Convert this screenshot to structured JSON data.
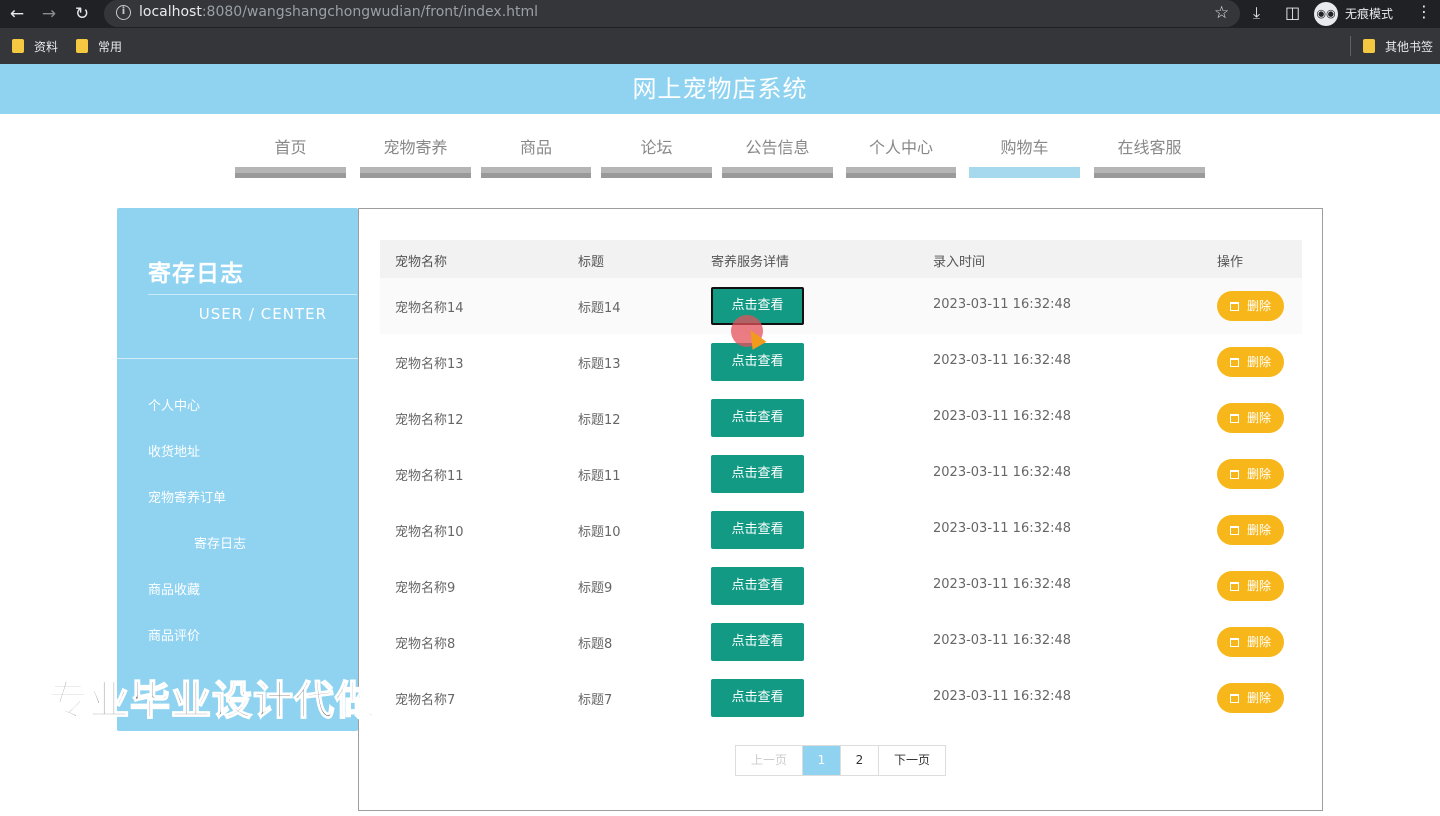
{
  "browser": {
    "url_host": "localhost",
    "url_path": ":8080/wangshangchongwudian/front/index.html",
    "incognito_label": "无痕模式",
    "bookmarks": [
      "资料",
      "常用"
    ],
    "other_bookmarks": "其他书签"
  },
  "site": {
    "title": "网上宠物店系统"
  },
  "nav": {
    "items": [
      "首页",
      "宠物寄养",
      "商品",
      "论坛",
      "公告信息",
      "个人中心",
      "购物车",
      "在线客服"
    ],
    "active_index": 6
  },
  "sidebar": {
    "title": "寄存日志",
    "subtitle": "USER / CENTER",
    "items": [
      "个人中心",
      "收货地址",
      "宠物寄养订单",
      "寄存日志",
      "商品收藏",
      "商品评价"
    ],
    "active_item": "寄存日志"
  },
  "watermark": "专业毕业设计代做",
  "table": {
    "headers": [
      "宠物名称",
      "标题",
      "寄养服务详情",
      "录入时间",
      "操作"
    ],
    "rows": [
      {
        "pet": "宠物名称14",
        "title": "标题14",
        "time": "2023-03-11 16:32:48"
      },
      {
        "pet": "宠物名称13",
        "title": "标题13",
        "time": "2023-03-11 16:32:48"
      },
      {
        "pet": "宠物名称12",
        "title": "标题12",
        "time": "2023-03-11 16:32:48"
      },
      {
        "pet": "宠物名称11",
        "title": "标题11",
        "time": "2023-03-11 16:32:48"
      },
      {
        "pet": "宠物名称10",
        "title": "标题10",
        "time": "2023-03-11 16:32:48"
      },
      {
        "pet": "宠物名称9",
        "title": "标题9",
        "time": "2023-03-11 16:32:48"
      },
      {
        "pet": "宠物名称8",
        "title": "标题8",
        "time": "2023-03-11 16:32:48"
      },
      {
        "pet": "宠物名称7",
        "title": "标题7",
        "time": "2023-03-11 16:32:48"
      }
    ],
    "view_label": "点击查看",
    "delete_label": "删除",
    "delete_icon": "trash-icon"
  },
  "pagination": {
    "prev": "上一页",
    "pages": [
      "1",
      "2"
    ],
    "current": "1",
    "next": "下一页"
  },
  "colors": {
    "brand": "#8fd3f1",
    "view_button": "#139a85",
    "delete_button": "#f7b71b"
  }
}
